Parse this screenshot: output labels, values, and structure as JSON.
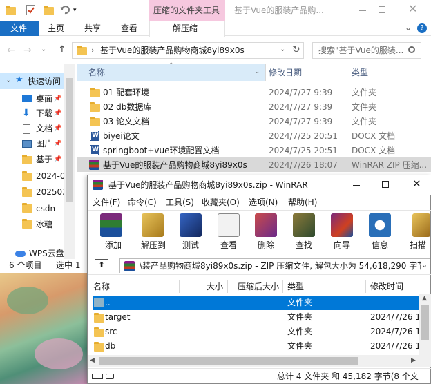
{
  "explorer": {
    "title": "基于Vue的服装产品购...",
    "ribbon_context_tab": "压缩的文件夹工具",
    "ribbon_tabs": [
      "文件",
      "主页",
      "共享",
      "查看"
    ],
    "ribbon_context_sub": "解压缩",
    "address": "基于Vue的服装产品购物商城8yi89x0s",
    "search_placeholder": "搜索\"基于Vue的服装...",
    "columns": {
      "name": "名称",
      "date": "修改日期",
      "type": "类型"
    },
    "files": [
      {
        "name": "01 配套环境",
        "date": "2024/7/27 9:39",
        "type": "文件夹",
        "icon": "folder-icon"
      },
      {
        "name": "02 db数据库",
        "date": "2024/7/27 9:39",
        "type": "文件夹",
        "icon": "folder-icon"
      },
      {
        "name": "03 论文文档",
        "date": "2024/7/27 9:39",
        "type": "文件夹",
        "icon": "folder-icon"
      },
      {
        "name": "biyei论文",
        "date": "2024/7/25 20:51",
        "type": "DOCX 文档",
        "icon": "docx-icon"
      },
      {
        "name": "springboot+vue环境配置文档",
        "date": "2024/7/25 20:51",
        "type": "DOCX 文档",
        "icon": "docx-icon"
      },
      {
        "name": "基于Vue的服装产品购物商城8yi89x0s",
        "date": "2024/7/26 18:07",
        "type": "WinRAR ZIP 压缩...",
        "icon": "winrar-archive-icon"
      }
    ],
    "nav": [
      {
        "label": "快速访问",
        "icon": "star-icon"
      },
      {
        "label": "桌面",
        "icon": "desktop-icon"
      },
      {
        "label": "下载",
        "icon": "download-icon"
      },
      {
        "label": "文档",
        "icon": "document-icon"
      },
      {
        "label": "图片",
        "icon": "picture-icon"
      },
      {
        "label": "基于",
        "icon": "folder-icon"
      },
      {
        "label": "2024-0",
        "icon": "folder-icon"
      },
      {
        "label": "202503",
        "icon": "folder-icon"
      },
      {
        "label": "csdn",
        "icon": "folder-icon"
      },
      {
        "label": "冰糖",
        "icon": "folder-icon"
      },
      {
        "label": "WPS云盘",
        "icon": "cloud-icon"
      }
    ],
    "status_items": "6 个项目",
    "status_selected": "选中 1"
  },
  "winrar": {
    "title": "基于Vue的服装产品购物商城8yi89x0s.zip - WinRAR",
    "menu": [
      "文件(F)",
      "命令(C)",
      "工具(S)",
      "收藏夹(O)",
      "选项(N)",
      "帮助(H)"
    ],
    "toolbar": [
      {
        "label": "添加",
        "icon": "add-archive-icon"
      },
      {
        "label": "解压到",
        "icon": "extract-to-icon"
      },
      {
        "label": "测试",
        "icon": "test-icon"
      },
      {
        "label": "查看",
        "icon": "view-icon"
      },
      {
        "label": "删除",
        "icon": "delete-icon"
      },
      {
        "label": "查找",
        "icon": "find-icon"
      },
      {
        "label": "向导",
        "icon": "wizard-icon"
      },
      {
        "label": "信息",
        "icon": "info-icon"
      },
      {
        "label": "扫描",
        "icon": "scan-icon"
      }
    ],
    "path": "\\装产品购物商城8yi89x0s.zip - ZIP 压缩文件, 解包大小为 54,618,290 字节",
    "columns": {
      "name": "名称",
      "size": "大小",
      "packed": "压缩后大小",
      "type": "类型",
      "modified": "修改时间"
    },
    "rows": [
      {
        "name": "..",
        "size": "",
        "packed": "",
        "type": "文件夹",
        "modified": ""
      },
      {
        "name": "target",
        "size": "",
        "packed": "",
        "type": "文件夹",
        "modified": "2024/7/26 18"
      },
      {
        "name": "src",
        "size": "",
        "packed": "",
        "type": "文件夹",
        "modified": "2024/7/26 18"
      },
      {
        "name": "db",
        "size": "",
        "packed": "",
        "type": "文件夹",
        "modified": "2024/7/26 18"
      }
    ],
    "status": "总计 4 文件夹 和 45,182 字节(8 个文"
  }
}
